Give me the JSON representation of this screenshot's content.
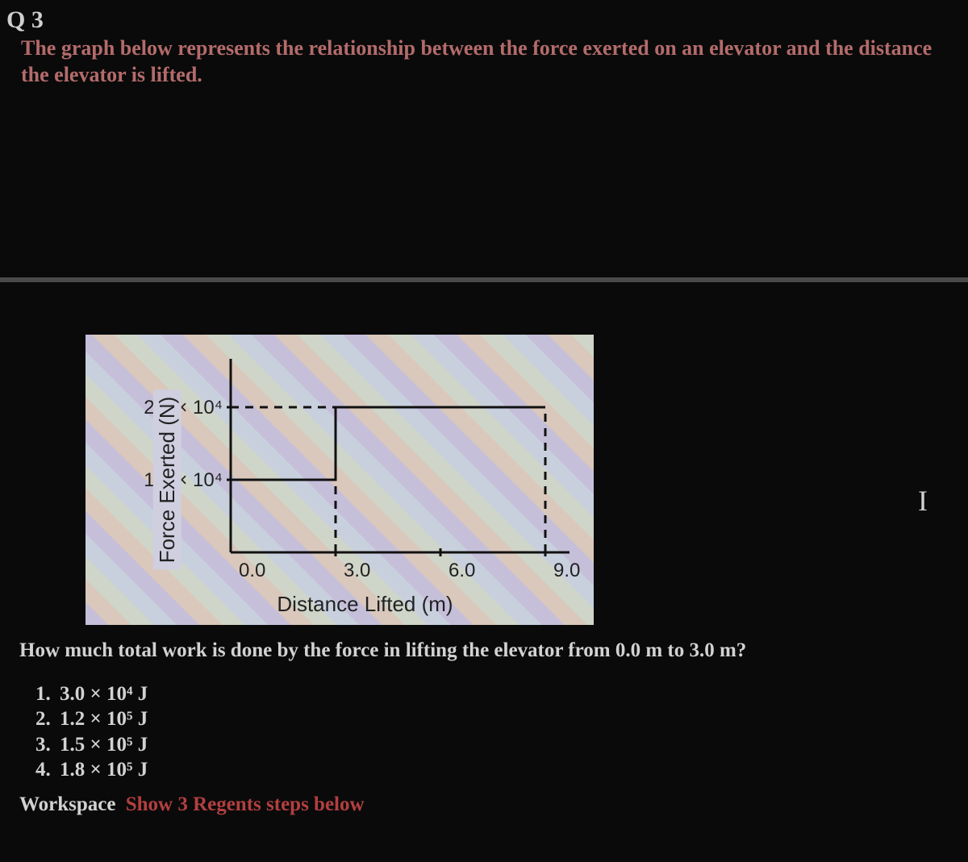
{
  "question_label": "Q 3",
  "intro_text": "The graph below represents the relationship between the force exerted on an elevator and the distance the elevator is lifted.",
  "chart_data": {
    "type": "line",
    "xlabel": "Distance Lifted (m)",
    "ylabel": "Force Exerted (N)",
    "x_ticks": [
      "0.0",
      "3.0",
      "6.0",
      "9.0"
    ],
    "y_ticks_html": [
      "1.0 × 10<sup>4</sup>",
      "2.0 × 10<sup>4</sup>"
    ],
    "y_tick_values": [
      10000,
      20000
    ],
    "xlim": [
      0.0,
      9.0
    ],
    "ylim": [
      0,
      25000
    ],
    "series": [
      {
        "name": "Force",
        "points": [
          [
            0.0,
            10000
          ],
          [
            3.0,
            10000
          ],
          [
            3.0,
            20000
          ],
          [
            9.0,
            20000
          ]
        ]
      }
    ],
    "guides": [
      {
        "from": [
          0.0,
          20000
        ],
        "to": [
          3.0,
          20000
        ],
        "dashed": true
      },
      {
        "from": [
          3.0,
          0
        ],
        "to": [
          3.0,
          10000
        ],
        "dashed": true
      },
      {
        "from": [
          9.0,
          0
        ],
        "to": [
          9.0,
          20000
        ],
        "dashed": true
      }
    ]
  },
  "question_line": "How much total work is done by the force in lifting the elevator from 0.0 m to 3.0 m?",
  "options": [
    "3.0 × 10⁴ J",
    "1.2 × 10⁵ J",
    "1.5 × 10⁵ J",
    "1.8 × 10⁵ J"
  ],
  "workspace_label": "Workspace",
  "workspace_link": "Show 3 Regents steps below",
  "cursor_glyph": "I"
}
